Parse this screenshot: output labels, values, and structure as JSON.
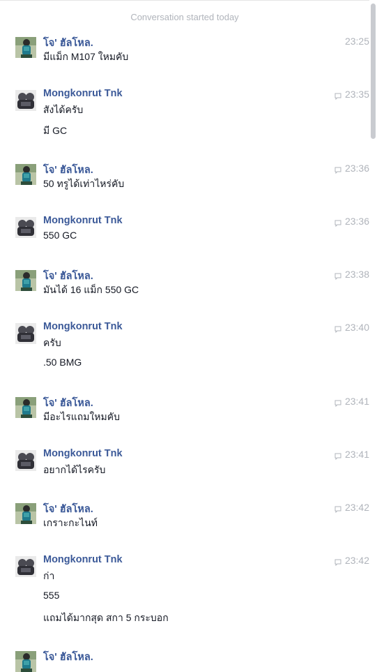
{
  "divider": "Conversation started today",
  "messages": [
    {
      "sender": "โจ' ฮัลโหล.",
      "avatar": "user-a",
      "time": "23:25",
      "seen_icon": false,
      "lines": [
        "มีแม็ก M107 ใหมคับ"
      ]
    },
    {
      "sender": "Mongkonrut Tnk",
      "avatar": "user-b",
      "time": "23:35",
      "seen_icon": true,
      "lines": [
        "สังได้ครับ",
        "มี GC"
      ]
    },
    {
      "sender": "โจ' ฮัลโหล.",
      "avatar": "user-a",
      "time": "23:36",
      "seen_icon": true,
      "lines": [
        "50 ทรูได้เท่าไหร่คับ"
      ]
    },
    {
      "sender": "Mongkonrut Tnk",
      "avatar": "user-b",
      "time": "23:36",
      "seen_icon": true,
      "lines": [
        "550 GC"
      ]
    },
    {
      "sender": "โจ' ฮัลโหล.",
      "avatar": "user-a",
      "time": "23:38",
      "seen_icon": true,
      "lines": [
        "มันได้ 16 แม็ก 550 GC"
      ]
    },
    {
      "sender": "Mongkonrut Tnk",
      "avatar": "user-b",
      "time": "23:40",
      "seen_icon": true,
      "lines": [
        "ครับ",
        ".50 BMG"
      ]
    },
    {
      "sender": "โจ' ฮัลโหล.",
      "avatar": "user-a",
      "time": "23:41",
      "seen_icon": true,
      "lines": [
        "มีอะไรแถมใหมคับ"
      ]
    },
    {
      "sender": "Mongkonrut Tnk",
      "avatar": "user-b",
      "time": "23:41",
      "seen_icon": true,
      "lines": [
        "อยากได้ไรครับ"
      ]
    },
    {
      "sender": "โจ' ฮัลโหล.",
      "avatar": "user-a",
      "time": "23:42",
      "seen_icon": true,
      "lines": [
        "เกราะกะไนท์"
      ]
    },
    {
      "sender": "Mongkonrut Tnk",
      "avatar": "user-b",
      "time": "23:42",
      "seen_icon": true,
      "lines": [
        "ก่า",
        "555",
        "แถมได้มากสุด สกา 5 กระบอก"
      ]
    },
    {
      "sender": "โจ' ฮัลโหล.",
      "avatar": "user-a",
      "time": "",
      "seen_icon": false,
      "lines": []
    }
  ],
  "colors": {
    "sender": "#3b5998",
    "text": "#141823",
    "muted": "#b0b4bb",
    "scroll_thumb": "#c9cbd0"
  }
}
